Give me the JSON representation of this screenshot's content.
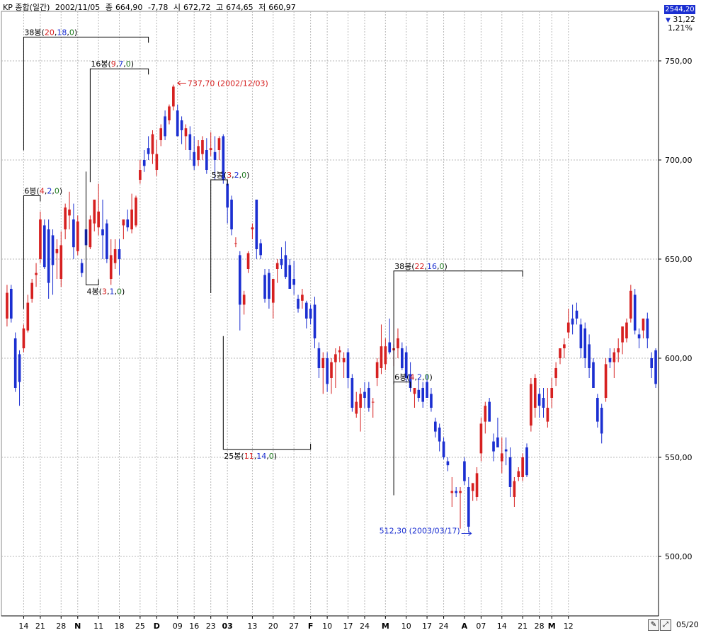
{
  "header": {
    "symbol": "KP 종합(일간)",
    "date": "2002/11/05",
    "close_label": "종",
    "close_value": "664,90",
    "change": "-7,78",
    "open_label": "시",
    "open_value": "672,72",
    "high_label": "고",
    "high_value": "674,65",
    "low_label": "저",
    "low_value": "660,97"
  },
  "right_panel": {
    "top_value": "2544,20",
    "delta": "31,22",
    "percent": "1,21%"
  },
  "toolbar": {
    "last_date": "05/20"
  },
  "colors": {
    "up": "#d62020",
    "down": "#1b2fd1",
    "grid": "#b8b8b8",
    "axis": "#000000",
    "annotation_red": "#d62020",
    "annotation_blue": "#1b2fd1",
    "annotation_green": "#1f7a1f"
  },
  "chart_data": {
    "type": "candlestick",
    "ylim": [
      470,
      775
    ],
    "y_ticks": [
      500,
      550,
      600,
      650,
      700,
      750
    ],
    "y_tick_labels": [
      "500,00",
      "550,00",
      "600,00",
      "650,00",
      "700,00",
      "750,00"
    ],
    "grid": true,
    "x_ticks": [
      {
        "index": 4,
        "label": "14",
        "bold": false
      },
      {
        "index": 8,
        "label": "21",
        "bold": false
      },
      {
        "index": 13,
        "label": "28",
        "bold": false
      },
      {
        "index": 17,
        "label": "N",
        "bold": true
      },
      {
        "index": 22,
        "label": "11",
        "bold": false
      },
      {
        "index": 27,
        "label": "18",
        "bold": false
      },
      {
        "index": 32,
        "label": "25",
        "bold": false
      },
      {
        "index": 36,
        "label": "D",
        "bold": true
      },
      {
        "index": 41,
        "label": "09",
        "bold": false
      },
      {
        "index": 45,
        "label": "16",
        "bold": false
      },
      {
        "index": 49,
        "label": "23",
        "bold": false
      },
      {
        "index": 53,
        "label": "03",
        "bold": true
      },
      {
        "index": 59,
        "label": "13",
        "bold": false
      },
      {
        "index": 64,
        "label": "20",
        "bold": false
      },
      {
        "index": 69,
        "label": "27",
        "bold": false
      },
      {
        "index": 73,
        "label": "F",
        "bold": true
      },
      {
        "index": 77,
        "label": "10",
        "bold": false
      },
      {
        "index": 82,
        "label": "17",
        "bold": false
      },
      {
        "index": 86,
        "label": "24",
        "bold": false
      },
      {
        "index": 91,
        "label": "M",
        "bold": true
      },
      {
        "index": 96,
        "label": "10",
        "bold": false
      },
      {
        "index": 101,
        "label": "17",
        "bold": false
      },
      {
        "index": 105,
        "label": "24",
        "bold": false
      },
      {
        "index": 110,
        "label": "A",
        "bold": true
      },
      {
        "index": 114,
        "label": "07",
        "bold": false
      },
      {
        "index": 119,
        "label": "14",
        "bold": false
      },
      {
        "index": 124,
        "label": "21",
        "bold": false
      },
      {
        "index": 128,
        "label": "28",
        "bold": false
      },
      {
        "index": 131,
        "label": "M",
        "bold": true
      },
      {
        "index": 135,
        "label": "12",
        "bold": false
      }
    ],
    "candles": [
      {
        "o": 620,
        "h": 637,
        "l": 616,
        "c": 633
      },
      {
        "o": 635,
        "h": 637,
        "l": 618,
        "c": 620
      },
      {
        "o": 610,
        "h": 613,
        "l": 583,
        "c": 585
      },
      {
        "o": 602,
        "h": 604,
        "l": 576,
        "c": 588
      },
      {
        "o": 605,
        "h": 617,
        "l": 603,
        "c": 615
      },
      {
        "o": 614,
        "h": 632,
        "l": 613,
        "c": 628
      },
      {
        "o": 630,
        "h": 640,
        "l": 628,
        "c": 638
      },
      {
        "o": 642,
        "h": 648,
        "l": 636,
        "c": 643
      },
      {
        "o": 650,
        "h": 674,
        "l": 648,
        "c": 670
      },
      {
        "o": 667,
        "h": 670,
        "l": 645,
        "c": 646
      },
      {
        "o": 665,
        "h": 670,
        "l": 630,
        "c": 638
      },
      {
        "o": 662,
        "h": 665,
        "l": 632,
        "c": 647
      },
      {
        "o": 653,
        "h": 660,
        "l": 640,
        "c": 655
      },
      {
        "o": 640,
        "h": 664,
        "l": 636,
        "c": 657
      },
      {
        "o": 665,
        "h": 678,
        "l": 660,
        "c": 676
      },
      {
        "o": 672,
        "h": 684,
        "l": 665,
        "c": 675
      },
      {
        "o": 670,
        "h": 678,
        "l": 650,
        "c": 656
      },
      {
        "o": 654,
        "h": 672,
        "l": 652,
        "c": 669
      },
      {
        "o": 648,
        "h": 650,
        "l": 641,
        "c": 643
      },
      {
        "o": 665,
        "h": 672,
        "l": 650,
        "c": 657
      },
      {
        "o": 656,
        "h": 672,
        "l": 655,
        "c": 670
      },
      {
        "o": 668,
        "h": 680,
        "l": 664,
        "c": 680
      },
      {
        "o": 666,
        "h": 688,
        "l": 662,
        "c": 674
      },
      {
        "o": 665,
        "h": 680,
        "l": 650,
        "c": 662
      },
      {
        "o": 668,
        "h": 670,
        "l": 648,
        "c": 650
      },
      {
        "o": 640,
        "h": 660,
        "l": 637,
        "c": 652
      },
      {
        "o": 648,
        "h": 660,
        "l": 645,
        "c": 655
      },
      {
        "o": 655,
        "h": 660,
        "l": 642,
        "c": 650
      },
      {
        "o": 667,
        "h": 670,
        "l": 660,
        "c": 670
      },
      {
        "o": 670,
        "h": 675,
        "l": 664,
        "c": 666
      },
      {
        "o": 665,
        "h": 683,
        "l": 663,
        "c": 675
      },
      {
        "o": 667,
        "h": 682,
        "l": 666,
        "c": 681
      },
      {
        "o": 690,
        "h": 700,
        "l": 688,
        "c": 695
      },
      {
        "o": 700,
        "h": 705,
        "l": 694,
        "c": 697
      },
      {
        "o": 706,
        "h": 712,
        "l": 700,
        "c": 703
      },
      {
        "o": 703,
        "h": 715,
        "l": 698,
        "c": 713
      },
      {
        "o": 695,
        "h": 710,
        "l": 692,
        "c": 703
      },
      {
        "o": 710,
        "h": 718,
        "l": 707,
        "c": 716
      },
      {
        "o": 722,
        "h": 725,
        "l": 710,
        "c": 712
      },
      {
        "o": 720,
        "h": 728,
        "l": 718,
        "c": 727
      },
      {
        "o": 727,
        "h": 738,
        "l": 725,
        "c": 737
      },
      {
        "o": 725,
        "h": 728,
        "l": 712,
        "c": 712
      },
      {
        "o": 720,
        "h": 722,
        "l": 708,
        "c": 715
      },
      {
        "o": 712,
        "h": 718,
        "l": 705,
        "c": 716
      },
      {
        "o": 713,
        "h": 717,
        "l": 700,
        "c": 705
      },
      {
        "o": 704,
        "h": 712,
        "l": 695,
        "c": 697
      },
      {
        "o": 700,
        "h": 710,
        "l": 697,
        "c": 707
      },
      {
        "o": 703,
        "h": 712,
        "l": 700,
        "c": 710
      },
      {
        "o": 705,
        "h": 711,
        "l": 693,
        "c": 695
      },
      {
        "o": 705,
        "h": 714,
        "l": 702,
        "c": 706
      },
      {
        "o": 704,
        "h": 712,
        "l": 690,
        "c": 700
      },
      {
        "o": 705,
        "h": 712,
        "l": 700,
        "c": 711
      },
      {
        "o": 712,
        "h": 713,
        "l": 688,
        "c": 690
      },
      {
        "o": 688,
        "h": 690,
        "l": 668,
        "c": 676
      },
      {
        "o": 680,
        "h": 682,
        "l": 662,
        "c": 665
      },
      {
        "o": 658,
        "h": 661,
        "l": 656,
        "c": 658
      },
      {
        "o": 652,
        "h": 654,
        "l": 614,
        "c": 627
      },
      {
        "o": 627,
        "h": 634,
        "l": 622,
        "c": 632
      },
      {
        "o": 645,
        "h": 654,
        "l": 643,
        "c": 653
      },
      {
        "o": 665,
        "h": 668,
        "l": 660,
        "c": 666
      },
      {
        "o": 680,
        "h": 680,
        "l": 650,
        "c": 655
      },
      {
        "o": 658,
        "h": 660,
        "l": 650,
        "c": 652
      },
      {
        "o": 642,
        "h": 645,
        "l": 628,
        "c": 630
      },
      {
        "o": 643,
        "h": 645,
        "l": 625,
        "c": 630
      },
      {
        "o": 628,
        "h": 630,
        "l": 620,
        "c": 640
      },
      {
        "o": 645,
        "h": 650,
        "l": 638,
        "c": 648
      },
      {
        "o": 650,
        "h": 656,
        "l": 645,
        "c": 647
      },
      {
        "o": 652,
        "h": 659,
        "l": 640,
        "c": 641
      },
      {
        "o": 647,
        "h": 650,
        "l": 635,
        "c": 635
      },
      {
        "o": 640,
        "h": 649,
        "l": 632,
        "c": 637
      },
      {
        "o": 630,
        "h": 632,
        "l": 623,
        "c": 625
      },
      {
        "o": 629,
        "h": 635,
        "l": 625,
        "c": 632
      },
      {
        "o": 628,
        "h": 629,
        "l": 615,
        "c": 620
      },
      {
        "o": 625,
        "h": 627,
        "l": 617,
        "c": 620
      },
      {
        "o": 627,
        "h": 631,
        "l": 605,
        "c": 610
      },
      {
        "o": 605,
        "h": 608,
        "l": 590,
        "c": 595
      },
      {
        "o": 595,
        "h": 603,
        "l": 582,
        "c": 600
      },
      {
        "o": 600,
        "h": 603,
        "l": 583,
        "c": 587
      },
      {
        "o": 590,
        "h": 600,
        "l": 582,
        "c": 598
      },
      {
        "o": 598,
        "h": 605,
        "l": 585,
        "c": 602
      },
      {
        "o": 603,
        "h": 606,
        "l": 598,
        "c": 604
      },
      {
        "o": 598,
        "h": 603,
        "l": 590,
        "c": 600
      },
      {
        "o": 603,
        "h": 605,
        "l": 585,
        "c": 590
      },
      {
        "o": 590,
        "h": 592,
        "l": 573,
        "c": 575
      },
      {
        "o": 572,
        "h": 583,
        "l": 570,
        "c": 578
      },
      {
        "o": 575,
        "h": 585,
        "l": 563,
        "c": 582
      },
      {
        "o": 583,
        "h": 588,
        "l": 575,
        "c": 580
      },
      {
        "o": 585,
        "h": 588,
        "l": 573,
        "c": 575
      },
      {
        "o": 578,
        "h": 580,
        "l": 570,
        "c": 578
      },
      {
        "o": 590,
        "h": 600,
        "l": 586,
        "c": 598
      },
      {
        "o": 595,
        "h": 617,
        "l": 592,
        "c": 606
      },
      {
        "o": 597,
        "h": 610,
        "l": 594,
        "c": 606
      },
      {
        "o": 608,
        "h": 620,
        "l": 602,
        "c": 603
      },
      {
        "o": 604,
        "h": 607,
        "l": 596,
        "c": 605
      },
      {
        "o": 605,
        "h": 615,
        "l": 600,
        "c": 610
      },
      {
        "o": 605,
        "h": 608,
        "l": 594,
        "c": 595
      },
      {
        "o": 603,
        "h": 606,
        "l": 588,
        "c": 590
      },
      {
        "o": 592,
        "h": 598,
        "l": 583,
        "c": 585
      },
      {
        "o": 582,
        "h": 585,
        "l": 575,
        "c": 585
      },
      {
        "o": 584,
        "h": 590,
        "l": 578,
        "c": 580
      },
      {
        "o": 585,
        "h": 588,
        "l": 575,
        "c": 578
      },
      {
        "o": 588,
        "h": 592,
        "l": 580,
        "c": 580
      },
      {
        "o": 582,
        "h": 585,
        "l": 573,
        "c": 575
      },
      {
        "o": 568,
        "h": 570,
        "l": 560,
        "c": 563
      },
      {
        "o": 565,
        "h": 567,
        "l": 553,
        "c": 558
      },
      {
        "o": 558,
        "h": 560,
        "l": 549,
        "c": 550
      },
      {
        "o": 548,
        "h": 550,
        "l": 543,
        "c": 546
      },
      {
        "o": 532,
        "h": 540,
        "l": 525,
        "c": 533
      },
      {
        "o": 533,
        "h": 535,
        "l": 530,
        "c": 532
      },
      {
        "o": 532,
        "h": 535,
        "l": 514,
        "c": 533
      },
      {
        "o": 548,
        "h": 550,
        "l": 536,
        "c": 538
      },
      {
        "o": 535,
        "h": 540,
        "l": 512,
        "c": 515
      },
      {
        "o": 533,
        "h": 537,
        "l": 528,
        "c": 537
      },
      {
        "o": 530,
        "h": 545,
        "l": 528,
        "c": 542
      },
      {
        "o": 552,
        "h": 570,
        "l": 548,
        "c": 567
      },
      {
        "o": 568,
        "h": 578,
        "l": 562,
        "c": 576
      },
      {
        "o": 578,
        "h": 580,
        "l": 568,
        "c": 568
      },
      {
        "o": 558,
        "h": 562,
        "l": 548,
        "c": 553
      },
      {
        "o": 560,
        "h": 570,
        "l": 558,
        "c": 555
      },
      {
        "o": 548,
        "h": 560,
        "l": 542,
        "c": 552
      },
      {
        "o": 554,
        "h": 560,
        "l": 546,
        "c": 553
      },
      {
        "o": 550,
        "h": 555,
        "l": 530,
        "c": 535
      },
      {
        "o": 530,
        "h": 540,
        "l": 525,
        "c": 538
      },
      {
        "o": 540,
        "h": 545,
        "l": 538,
        "c": 543
      },
      {
        "o": 540,
        "h": 552,
        "l": 538,
        "c": 550
      },
      {
        "o": 555,
        "h": 557,
        "l": 540,
        "c": 541
      },
      {
        "o": 566,
        "h": 590,
        "l": 563,
        "c": 587
      },
      {
        "o": 575,
        "h": 592,
        "l": 570,
        "c": 590
      },
      {
        "o": 582,
        "h": 585,
        "l": 570,
        "c": 576
      },
      {
        "o": 580,
        "h": 585,
        "l": 570,
        "c": 575
      },
      {
        "o": 568,
        "h": 585,
        "l": 565,
        "c": 575
      },
      {
        "o": 580,
        "h": 590,
        "l": 575,
        "c": 585
      },
      {
        "o": 590,
        "h": 598,
        "l": 586,
        "c": 595
      },
      {
        "o": 600,
        "h": 605,
        "l": 597,
        "c": 605
      },
      {
        "o": 605,
        "h": 610,
        "l": 600,
        "c": 607
      },
      {
        "o": 613,
        "h": 625,
        "l": 610,
        "c": 618
      },
      {
        "o": 620,
        "h": 627,
        "l": 612,
        "c": 617
      },
      {
        "o": 624,
        "h": 628,
        "l": 617,
        "c": 620
      },
      {
        "o": 617,
        "h": 620,
        "l": 600,
        "c": 605
      },
      {
        "o": 615,
        "h": 618,
        "l": 595,
        "c": 600
      },
      {
        "o": 607,
        "h": 612,
        "l": 590,
        "c": 595
      },
      {
        "o": 598,
        "h": 600,
        "l": 585,
        "c": 585
      },
      {
        "o": 580,
        "h": 582,
        "l": 565,
        "c": 568
      },
      {
        "o": 575,
        "h": 577,
        "l": 557,
        "c": 562
      },
      {
        "o": 580,
        "h": 600,
        "l": 578,
        "c": 597
      },
      {
        "o": 600,
        "h": 605,
        "l": 595,
        "c": 598
      },
      {
        "o": 598,
        "h": 605,
        "l": 590,
        "c": 603
      },
      {
        "o": 603,
        "h": 610,
        "l": 598,
        "c": 605
      },
      {
        "o": 608,
        "h": 612,
        "l": 602,
        "c": 616
      },
      {
        "o": 610,
        "h": 620,
        "l": 608,
        "c": 618
      },
      {
        "o": 620,
        "h": 637,
        "l": 618,
        "c": 634
      },
      {
        "o": 632,
        "h": 635,
        "l": 612,
        "c": 614
      },
      {
        "o": 612,
        "h": 615,
        "l": 605,
        "c": 610
      },
      {
        "o": 614,
        "h": 620,
        "l": 610,
        "c": 620
      },
      {
        "o": 620,
        "h": 623,
        "l": 605,
        "c": 610
      },
      {
        "o": 600,
        "h": 603,
        "l": 590,
        "c": 595
      },
      {
        "o": 604,
        "h": 605,
        "l": 585,
        "c": 587
      }
    ],
    "annotations": [
      {
        "kind": "range",
        "start": 4,
        "end": 34,
        "value": 762,
        "side": "above",
        "prefix": "38봉(",
        "up": "20",
        "down": "18",
        "flat": "0",
        "suffix": ")"
      },
      {
        "kind": "range",
        "start": 4,
        "end": 8,
        "value": 682,
        "side": "above",
        "prefix": "6봉(",
        "up": "4",
        "down": "2",
        "flat": "0",
        "suffix": ")"
      },
      {
        "kind": "range",
        "start": 20,
        "end": 34,
        "value": 746,
        "side": "above",
        "prefix": "16봉(",
        "up": "9",
        "down": "7",
        "flat": "0",
        "suffix": ")"
      },
      {
        "kind": "range",
        "start": 19,
        "end": 22,
        "value": 637,
        "side": "below",
        "prefix": "4봉(",
        "up": "3",
        "down": "1",
        "flat": "0",
        "suffix": ")"
      },
      {
        "kind": "range",
        "start": 49,
        "end": 53,
        "value": 690,
        "side": "above",
        "prefix": "5봉(",
        "up": "3",
        "down": "2",
        "flat": "0",
        "suffix": ")"
      },
      {
        "kind": "range",
        "start": 52,
        "end": 73,
        "value": 554,
        "side": "below",
        "prefix": "25봉(",
        "up": "11",
        "down": "14",
        "flat": "0",
        "suffix": ")"
      },
      {
        "kind": "range",
        "start": 93,
        "end": 124,
        "value": 644,
        "side": "above",
        "prefix": "38봉(",
        "up": "22",
        "down": "16",
        "flat": "0",
        "suffix": ")"
      },
      {
        "kind": "range",
        "start": 93,
        "end": 97,
        "value": 588,
        "side": "above",
        "prefix": "6봉(",
        "up": "4",
        "down": "2",
        "flat": "0",
        "suffix": ")"
      }
    ],
    "price_labels": [
      {
        "index": 40,
        "value": 737.7,
        "text": "737,70 (2002/12/03)",
        "color": "red",
        "side": "right"
      },
      {
        "index": 112,
        "value": 512.3,
        "text": "512,30 (2003/03/17)",
        "color": "blue",
        "side": "left"
      }
    ]
  }
}
